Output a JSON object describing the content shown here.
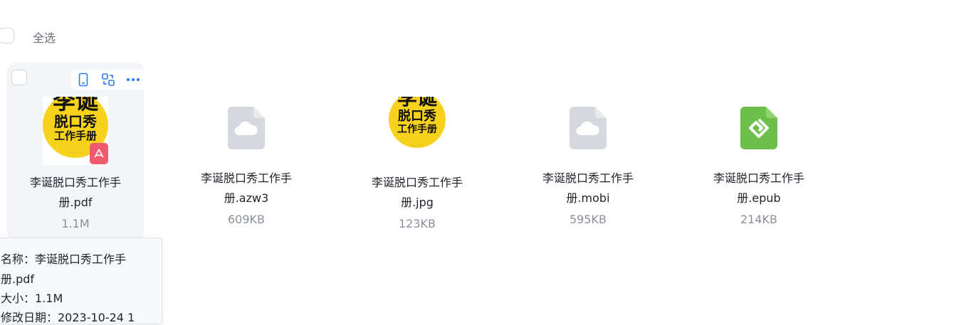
{
  "toolbar": {
    "select_all_label": "全选"
  },
  "files": [
    {
      "name_line1": "李诞脱口秀工作手",
      "name_line2": "册.pdf",
      "size": "1.1M",
      "type": "pdf",
      "icon": "book-cover-thumbnail"
    },
    {
      "name_line1": "李诞脱口秀工作手",
      "name_line2": "册.azw3",
      "size": "609KB",
      "type": "azw3",
      "icon": "cloud-file-icon"
    },
    {
      "name_line1": "李诞脱口秀工作手",
      "name_line2": "册.jpg",
      "size": "123KB",
      "type": "jpg",
      "icon": "image-thumbnail"
    },
    {
      "name_line1": "李诞脱口秀工作手",
      "name_line2": "册.mobi",
      "size": "595KB",
      "type": "mobi",
      "icon": "cloud-file-icon"
    },
    {
      "name_line1": "李诞脱口秀工作手",
      "name_line2": "册.epub",
      "size": "214KB",
      "type": "epub",
      "icon": "epub-icon"
    }
  ],
  "cover": {
    "line1": "李诞",
    "line2": "脱口秀",
    "line3": "工作手册"
  },
  "tooltip": {
    "name_line1": "名称：李诞脱口秀工作手",
    "name_line2": "册.pdf",
    "size_line": "大小：1.1M",
    "date_line": "修改日期：2023-10-24 1"
  },
  "colors": {
    "accent": "#2b7de9",
    "pdf_badge": "#f05a6e",
    "epub_green": "#6cc04a",
    "cloud_grey": "#d5d8de",
    "cover_yellow": "#f7d21c"
  }
}
